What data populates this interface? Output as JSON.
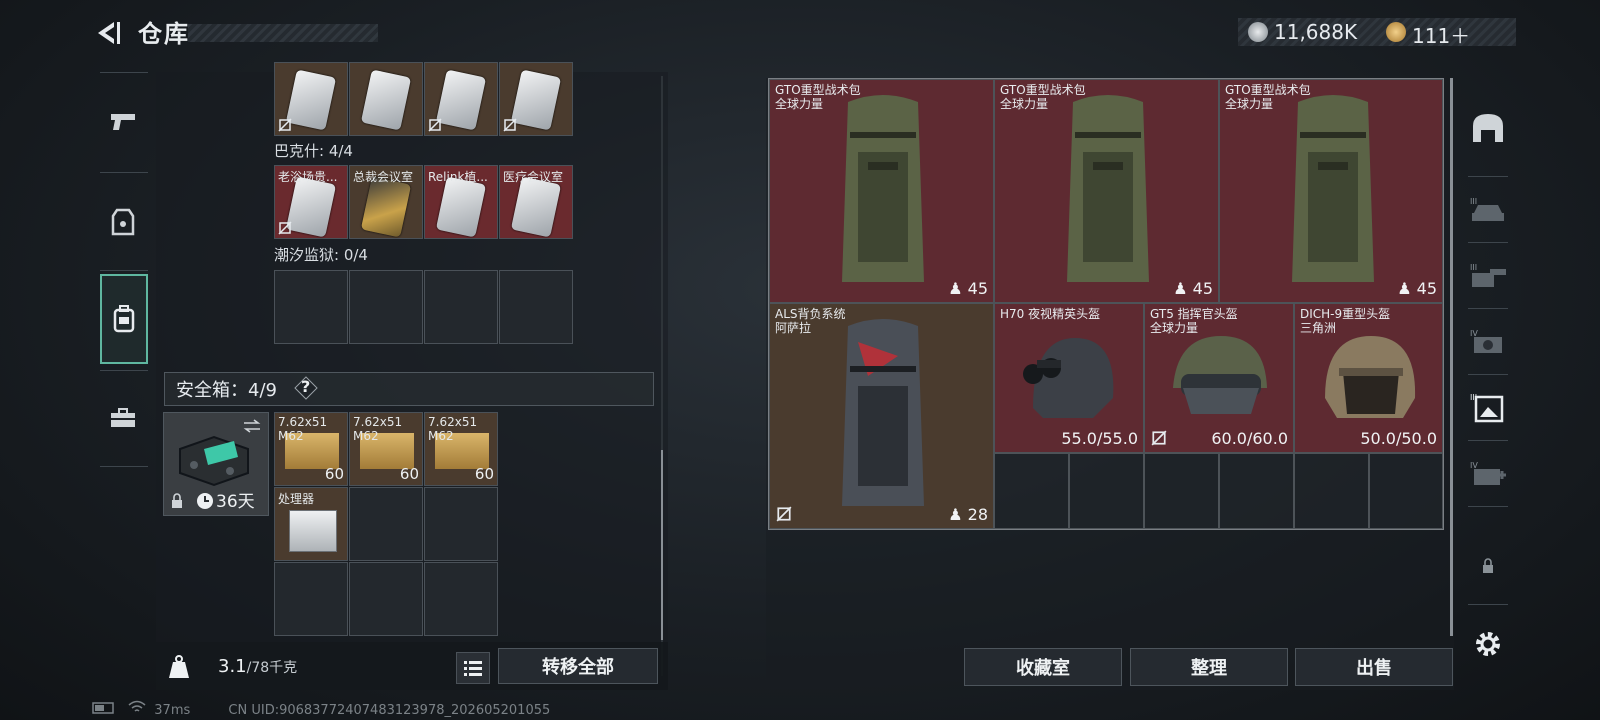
{
  "header": {
    "title": "仓库",
    "currency": [
      {
        "icon": "silver-coin-icon",
        "value": "11,688K"
      },
      {
        "icon": "gold-coin-icon",
        "value": "111＋"
      }
    ]
  },
  "left_tabs": [
    {
      "icon": "pistol-icon",
      "active": false
    },
    {
      "icon": "vest-icon",
      "active": false
    },
    {
      "icon": "backpack-icon",
      "active": true
    },
    {
      "icon": "toolbox-icon",
      "active": false
    }
  ],
  "keycards": {
    "row1": [
      {
        "label": "",
        "color": "silver",
        "no_loot": true
      },
      {
        "label": "",
        "color": "silver",
        "no_loot": false
      },
      {
        "label": "",
        "color": "silver",
        "no_loot": true
      },
      {
        "label": "",
        "color": "silver",
        "no_loot": true
      }
    ],
    "group2_label": "巴克什: 4/4",
    "row2": [
      {
        "label": "老浴场贵...",
        "color": "silver",
        "no_loot": true
      },
      {
        "label": "总裁会议室",
        "color": "gold",
        "no_loot": false
      },
      {
        "label": "Relink植...",
        "color": "silver",
        "no_loot": false
      },
      {
        "label": "医疗会议室",
        "color": "silver",
        "no_loot": false
      }
    ],
    "group3_label": "潮汐监狱: 0/4"
  },
  "safe_box": {
    "label": "安全箱：4/9",
    "help": "?",
    "expiry": "36天",
    "items": [
      {
        "name": "7.62x51\nM62",
        "qty": "60"
      },
      {
        "name": "7.62x51\nM62",
        "qty": "60"
      },
      {
        "name": "7.62x51\nM62",
        "qty": "60"
      },
      {
        "name": "处理器",
        "qty": ""
      }
    ]
  },
  "bottom": {
    "weight_value": "3.1",
    "weight_max": "/78千克",
    "transfer_all": "转移全部"
  },
  "storage": {
    "items": [
      {
        "name": "GTO重型战术包",
        "sub": "全球力量",
        "val": "45"
      },
      {
        "name": "GTO重型战术包",
        "sub": "全球力量",
        "val": "45"
      },
      {
        "name": "GTO重型战术包",
        "sub": "全球力量",
        "val": "45"
      },
      {
        "name": "ALS背负系统",
        "sub": "阿萨拉",
        "val": "28"
      },
      {
        "name": "H70 夜视精英头盔",
        "sub": "",
        "val": "55.0/55.0"
      },
      {
        "name": "GT5 指挥官头盔",
        "sub": "全球力量",
        "val": "60.0/60.0"
      },
      {
        "name": "DICH-9重型头盔",
        "sub": "三角洲",
        "val": "50.0/50.0"
      }
    ]
  },
  "right_buttons": {
    "collection": "收藏室",
    "organize": "整理",
    "sell": "出售"
  },
  "right_tabs": [
    {
      "icon": "helmet-icon",
      "level": ""
    },
    {
      "icon": "vehicle-icon",
      "level": "III"
    },
    {
      "icon": "turret-icon",
      "level": "III"
    },
    {
      "icon": "camera-icon",
      "level": "IV"
    },
    {
      "icon": "image-icon",
      "level": "III"
    },
    {
      "icon": "medkit-icon",
      "level": "IV"
    },
    {
      "icon": "lock-icon",
      "level": ""
    },
    {
      "icon": "settings-icon",
      "level": ""
    }
  ],
  "status": {
    "ping": "37ms",
    "uid": "CN UID:906837724074831239​78_202605201055"
  }
}
